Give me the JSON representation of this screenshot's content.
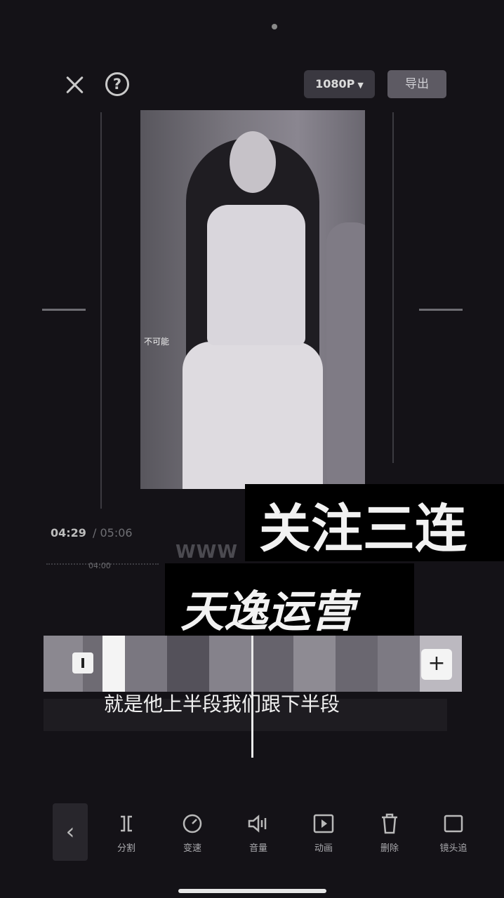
{
  "header": {
    "resolution_label": "1080P",
    "export_label": "导出"
  },
  "preview": {
    "overlay_subtitle": "不可能"
  },
  "timeline": {
    "current_time": "04:29",
    "total_time": "/ 05:06",
    "ruler_tick": "04:00",
    "watermark_text": "WWW",
    "clip_caption": "就是他上半段我们跟下半段"
  },
  "promo_overlay": {
    "line1": "关注三连",
    "line2": "天逸运营"
  },
  "toolbar": {
    "items": [
      {
        "label": "分割",
        "icon": "split-icon"
      },
      {
        "label": "变速",
        "icon": "speed-icon"
      },
      {
        "label": "音量",
        "icon": "volume-icon"
      },
      {
        "label": "动画",
        "icon": "animation-icon"
      },
      {
        "label": "删除",
        "icon": "delete-icon"
      },
      {
        "label": "镜头追",
        "icon": "camera-track-icon"
      }
    ]
  }
}
